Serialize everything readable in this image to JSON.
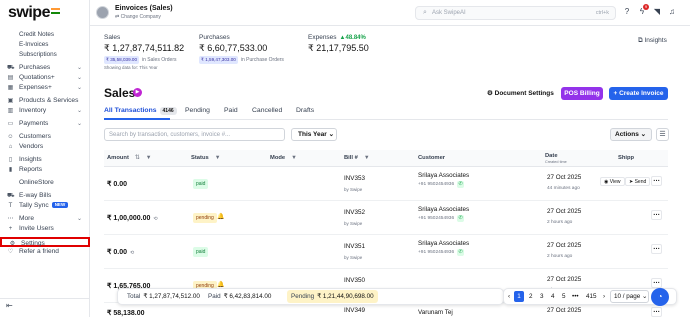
{
  "brand": {
    "logo": "swipe"
  },
  "sidebar": {
    "items": [
      {
        "label": "Credit Notes",
        "type": "sub"
      },
      {
        "label": "E-Invoices",
        "type": "sub"
      },
      {
        "label": "Subscriptions",
        "type": "sub"
      },
      {
        "label": "Purchases",
        "type": "main",
        "icon": "cart-icon",
        "chevron": true
      },
      {
        "label": "Quotations+",
        "type": "main",
        "icon": "document-icon",
        "chevron": true
      },
      {
        "label": "Expenses+",
        "type": "main",
        "icon": "receipt-icon",
        "chevron": true
      },
      {
        "label": "Products & Services",
        "type": "main",
        "icon": "box-icon"
      },
      {
        "label": "Inventory",
        "type": "main",
        "icon": "inventory-icon",
        "chevron": true
      },
      {
        "label": "Payments",
        "type": "main",
        "icon": "wallet-icon",
        "chevron": true
      },
      {
        "label": "Customers",
        "type": "main",
        "icon": "user-icon"
      },
      {
        "label": "Vendors",
        "type": "main",
        "icon": "vendor-icon"
      },
      {
        "label": "Insights",
        "type": "main",
        "icon": "chart-icon"
      },
      {
        "label": "Reports",
        "type": "main",
        "icon": "report-icon"
      },
      {
        "label": "OnlineStore",
        "type": "main",
        "icon": "store-icon"
      },
      {
        "label": "E-way Bills",
        "type": "main",
        "icon": "truck-icon"
      },
      {
        "label": "Tally Sync",
        "type": "main",
        "icon": "sync-icon",
        "badge": "NEW"
      },
      {
        "label": "More",
        "type": "main",
        "icon": "more-icon",
        "chevron": true
      },
      {
        "label": "Invite Users",
        "type": "main",
        "icon": "invite-icon"
      },
      {
        "label": "Settings",
        "type": "main",
        "icon": "gear-icon"
      },
      {
        "label": "Refer a friend",
        "type": "main",
        "icon": "gift-icon"
      }
    ],
    "collapse_icon": "⇤"
  },
  "header": {
    "company_name": "Einvoices (Sales)",
    "change_company": "⇄ Change Company",
    "search_placeholder": "Ask SwipeAI",
    "search_shortcut": "ctrl+k",
    "notification_count": "9"
  },
  "stats": {
    "sales": {
      "label": "Sales",
      "value": "₹ 1,27,87,74,511.82",
      "chip": "₹ 35,58,039.00",
      "chip_note": "in Sales Orders"
    },
    "purchases": {
      "label": "Purchases",
      "value": "₹ 6,60,77,533.00",
      "chip": "₹ 1,59,47,303.00",
      "chip_note": "in Purchase Orders"
    },
    "expenses": {
      "label": "Expenses",
      "value": "₹ 21,17,795.50",
      "change": "48.84%"
    },
    "showing_note": "Showing data for: This Year",
    "insights_label": "Insights"
  },
  "sales_header": {
    "title": "Sales",
    "document_settings": "Document Settings",
    "pos_billing": "POS Billing",
    "create_invoice": "+ Create Invoice"
  },
  "tabs": [
    {
      "label": "All Transactions",
      "count": "4146",
      "active": true
    },
    {
      "label": "Pending"
    },
    {
      "label": "Paid"
    },
    {
      "label": "Cancelled"
    },
    {
      "label": "Drafts"
    }
  ],
  "filters": {
    "search_placeholder": "Search by transaction, customers, invoice #...",
    "period": "This Year",
    "actions": "Actions"
  },
  "table": {
    "columns": {
      "amount": "Amount",
      "status": "Status",
      "mode": "Mode",
      "bill": "Bill #",
      "customer": "Customer",
      "date": "Date",
      "date_sub": "Created time",
      "ship": "Shipp"
    },
    "rows": [
      {
        "amount": "₹ 0.00",
        "status": "paid",
        "bill": "INV353",
        "by": "by Swipe",
        "customer": "Srilaya Associates",
        "phone": "+91 9502454936",
        "date": "27 Oct 2025",
        "ago": "44 minutes ago",
        "view": "View",
        "send": "Send"
      },
      {
        "amount": "₹ 1,00,000.00",
        "amount_icon": "⟲",
        "status": "pending",
        "bill": "INV352",
        "by": "by Swipe",
        "customer": "Srilaya Associates",
        "phone": "+91 9502454936",
        "date": "27 Oct 2025",
        "ago": "2 hours ago"
      },
      {
        "amount": "₹ 0.00",
        "amount_icon": "⟲",
        "status": "paid",
        "bill": "INV351",
        "by": "by Swipe",
        "customer": "Srilaya Associates",
        "phone": "+91 9502454936",
        "date": "27 Oct 2025",
        "ago": "2 hours ago"
      },
      {
        "amount": "₹ 1,65,765.00",
        "status": "pending",
        "bill": "INV350",
        "by": "by Swipe",
        "customer": "",
        "phone": "",
        "date": "27 Oct 2025",
        "ago": "2 hours ago"
      },
      {
        "amount": "₹ 58,138.00",
        "status": "",
        "bill": "INV349",
        "by": "",
        "customer": "Varunam Tej",
        "phone": "",
        "date": "27 Oct 2025",
        "ago": ""
      }
    ]
  },
  "totals": {
    "total_label": "Total",
    "total_value": "₹ 1,27,87,74,512.00",
    "paid_label": "Paid",
    "paid_value": "₹ 6,42,83,814.00",
    "pending_label": "Pending",
    "pending_value": "₹ 1,21,44,90,698.00"
  },
  "pagination": {
    "pages": [
      "1",
      "2",
      "3",
      "4",
      "5",
      "•••",
      "415"
    ],
    "current": "1",
    "per_page": "10 / page"
  },
  "colors": {
    "primary": "#2563eb",
    "pos": "#9333ea",
    "highlight_border": "#e00000",
    "paid": "#15803d",
    "pending": "#92400e"
  }
}
